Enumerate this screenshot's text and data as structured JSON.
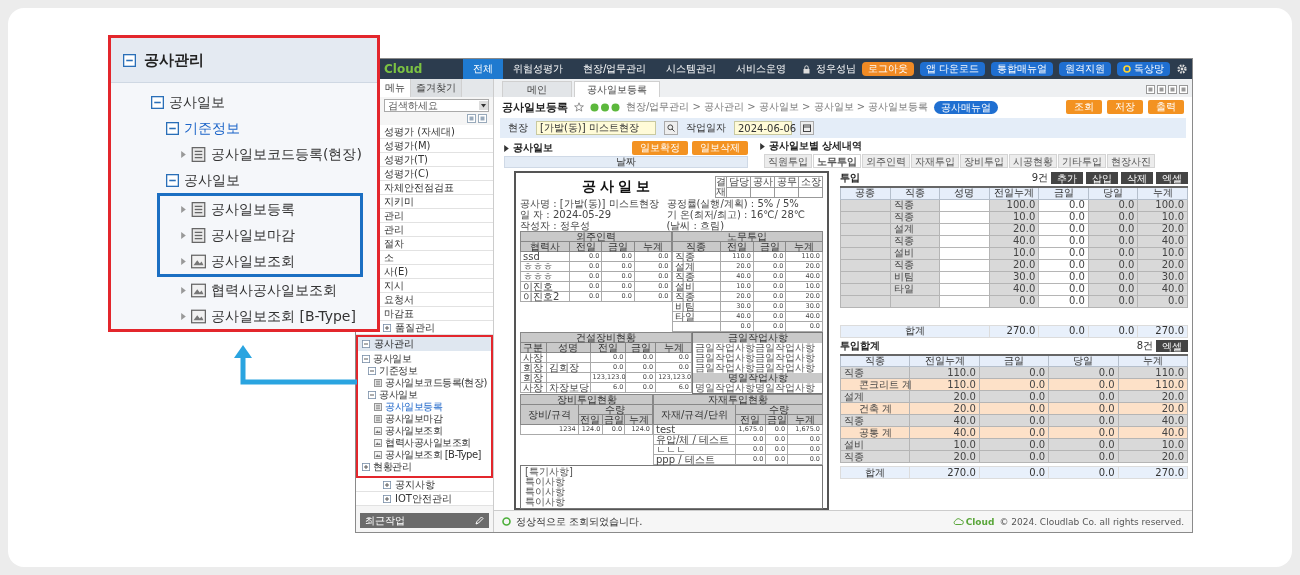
{
  "callout": {
    "title": "공사관리",
    "expanded": true,
    "tree": [
      {
        "label": "공사일보",
        "kind": "folder",
        "expanded": true,
        "selected": false,
        "children": [
          {
            "label": "기준정보",
            "kind": "folder",
            "expanded": true,
            "selected": true,
            "children": [
              {
                "label": "공사일보코드등록(현장)",
                "kind": "document",
                "selected": false
              }
            ]
          },
          {
            "label": "공사일보",
            "kind": "folder",
            "expanded": true,
            "selected": false,
            "children": [
              {
                "label": "공사일보등록",
                "kind": "document",
                "selected": false,
                "framed": true
              },
              {
                "label": "공사일보마감",
                "kind": "document",
                "selected": false,
                "framed": true
              },
              {
                "label": "공사일보조회",
                "kind": "report",
                "selected": false,
                "framed": true
              },
              {
                "label": "협력사공사일보조회",
                "kind": "report",
                "selected": false,
                "framed": false
              },
              {
                "label": "공사일보조회 [B-Type]",
                "kind": "report",
                "selected": false,
                "framed": false
              }
            ]
          }
        ]
      }
    ]
  },
  "topbar": {
    "logo": "Cloud",
    "menus": [
      {
        "label": "전체",
        "selected": true
      },
      {
        "label": "위험성평가",
        "selected": false
      },
      {
        "label": "현장/업무관리",
        "selected": false
      },
      {
        "label": "시스템관리",
        "selected": false
      },
      {
        "label": "서비스운영",
        "selected": false
      }
    ],
    "user": "정우성님",
    "logout": "로그아웃",
    "links": [
      "앱 다운로드",
      "통합매뉴얼",
      "원격지원"
    ],
    "status_link": "독상망"
  },
  "sidebar": {
    "tabs": [
      {
        "label": "메뉴",
        "selected": true
      },
      {
        "label": "즐겨찾기",
        "selected": false
      }
    ],
    "search": "검색하세요",
    "items": [
      {
        "label": "성평가 (자세대)",
        "kind": "plain"
      },
      {
        "label": "성평가(M)",
        "kind": "plain"
      },
      {
        "label": "성평가(T)",
        "kind": "plain"
      },
      {
        "label": "성평가(C)",
        "kind": "plain"
      },
      {
        "label": "자체안전점검표",
        "kind": "plain"
      },
      {
        "label": "지키미",
        "kind": "plain"
      },
      {
        "label": "관리",
        "kind": "plain"
      },
      {
        "label": "관리",
        "kind": "plain"
      },
      {
        "label": "절차",
        "kind": "plain"
      },
      {
        "label": "소",
        "kind": "plain"
      },
      {
        "label": "사(E)",
        "kind": "plain"
      },
      {
        "label": "지시",
        "kind": "plain"
      },
      {
        "label": "요청서",
        "kind": "plain"
      },
      {
        "label": "마감표",
        "kind": "plain"
      },
      {
        "label": "품질관리",
        "kind": "folder",
        "expanded": false
      },
      {
        "label": "공사관리",
        "kind": "folder",
        "expanded": true,
        "framed": true,
        "children": [
          {
            "label": "공사일보",
            "kind": "folder",
            "expanded": true,
            "selected": false,
            "children": [
              {
                "label": "기준정보",
                "kind": "folder",
                "expanded": true,
                "selected": false,
                "children": [
                  {
                    "label": "공사일보코드등록(현장)",
                    "kind": "document",
                    "selected": false
                  }
                ]
              },
              {
                "label": "공사일보",
                "kind": "folder",
                "expanded": true,
                "selected": false,
                "children": [
                  {
                    "label": "공사일보등록",
                    "kind": "document",
                    "selected": true
                  },
                  {
                    "label": "공사일보마감",
                    "kind": "document",
                    "selected": false
                  },
                  {
                    "label": "공사일보조회",
                    "kind": "report",
                    "selected": false
                  },
                  {
                    "label": "협력사공사일보조회",
                    "kind": "report",
                    "selected": false
                  },
                  {
                    "label": "공사일보조회 [B-Type]",
                    "kind": "report",
                    "selected": false
                  }
                ]
              }
            ]
          },
          {
            "label": "현황관리",
            "kind": "folder",
            "expanded": false,
            "selected": false
          }
        ]
      },
      {
        "label": "공지사항",
        "kind": "folder",
        "expanded": false
      },
      {
        "label": "IOT안전관리",
        "kind": "folder",
        "expanded": false
      }
    ],
    "recent": "최근작업"
  },
  "main": {
    "tabs": [
      {
        "label": "메인",
        "selected": false
      },
      {
        "label": "공사일보등록",
        "selected": true
      }
    ],
    "title": "공사일보등록",
    "breadcrumb": "현장/업무관리 > 공사관리 > 공사일보 > 공사일보 > 공사일보등록",
    "manual_button": "공사매뉴얼",
    "actions": [
      "조회",
      "저장",
      "출력"
    ],
    "filters": [
      {
        "label": "현장",
        "value": "[가발(동)] 미스트현장",
        "kind": "search"
      },
      {
        "label": "작업일자",
        "value": "2024-06-06",
        "kind": "date"
      }
    ],
    "daily_panel": {
      "title": "공사일보",
      "buttons": [
        "일보확정",
        "일보삭제"
      ],
      "column": "날짜"
    },
    "report": {
      "title": "공사일보",
      "approval": {
        "label": "결재",
        "roles": [
          "담당",
          "공사",
          "공무",
          "소장"
        ]
      },
      "info_left": [
        "공사명 : [가발(동)] 미스트현장",
        "일 자 : 2024-05-29",
        "작성자 : 정우성"
      ],
      "info_right": [
        "공정률(실행/계획) : 5% / 5%",
        "기 온(최저/최고) : 16℃/ 28℃",
        "(날씨 : 흐림)"
      ],
      "outsourcing": {
        "title": "외주인력",
        "columns": [
          "협력사",
          "전일",
          "금일",
          "누계"
        ],
        "rows": [
          [
            "ssd",
            "0.0",
            "0.0",
            "0.0"
          ],
          [
            "ㅎㅎㅎ",
            "0.0",
            "0.0",
            "0.0"
          ],
          [
            "ㅎㅎㅎ",
            "0.0",
            "0.0",
            "0.0"
          ],
          [
            "이진호",
            "0.0",
            "0.0",
            "0.0"
          ],
          [
            "이진호2",
            "0.0",
            "0.0",
            "0.0"
          ]
        ]
      },
      "labor": {
        "title": "노무투입",
        "columns": [
          "직종",
          "전일",
          "금일",
          "누계"
        ],
        "rows": [
          [
            "직종",
            "110.0",
            "0.0",
            "110.0"
          ],
          [
            "설계",
            "20.0",
            "0.0",
            "20.0"
          ],
          [
            "직종",
            "40.0",
            "0.0",
            "40.0"
          ],
          [
            "설비",
            "10.0",
            "0.0",
            "10.0"
          ],
          [
            "직종",
            "20.0",
            "0.0",
            "20.0"
          ],
          [
            "비팀",
            "30.0",
            "0.0",
            "30.0"
          ],
          [
            "타일",
            "40.0",
            "0.0",
            "40.0"
          ],
          [
            null,
            "0.0",
            "0.0",
            "0.0"
          ]
        ]
      },
      "equipment": {
        "title": "건설장비현황",
        "columns": [
          "구분",
          "성명",
          "전일",
          "금일",
          "누계"
        ],
        "rows": [
          [
            "사장",
            null,
            "0.0",
            "0.0",
            "0.0"
          ],
          [
            "회장",
            "김회장",
            "0.0",
            "0.0",
            "0.0"
          ],
          [
            "회장",
            null,
            "123,123.0",
            "0.0",
            "123,123.0"
          ],
          [
            "사장",
            "차장보당",
            "6.0",
            "0.0",
            "6.0"
          ]
        ]
      },
      "work_notes": [
        {
          "title": "금일작업사항",
          "lines": [
            "금일작업사항금일작업사항",
            "금일작업사항금일작업사항",
            "금일작업사항금일작업사항"
          ]
        },
        {
          "title": "명일작업사항",
          "lines": [
            "명일작업사항명일작업사항"
          ]
        }
      ],
      "equipment_input": {
        "title": "장비투입현황",
        "group": "수량",
        "columns": [
          "장비/규격",
          "전일",
          "금일",
          "누계"
        ],
        "rows": [
          [
            "1234",
            "124.0",
            "0.0",
            "124.0"
          ]
        ]
      },
      "material_input": {
        "title": "자재투입현황",
        "group": "수량",
        "columns": [
          "자재/규격/단위",
          "전일",
          "금일",
          "누계"
        ],
        "rows": [
          [
            "test",
            "1,675.0",
            "0.0",
            "1,675.0"
          ],
          [
            "유압/체 / 테스트",
            "0.0",
            "0.0",
            "0.0"
          ],
          [
            "ㄴㄴㄴ",
            "0.0",
            "0.0",
            "0.0"
          ],
          [
            "ppp / 테스트",
            "0.0",
            "0.0",
            "0.0"
          ]
        ]
      },
      "notes": [
        "[특기사항]",
        "특이사항",
        "특이사항",
        "특이사항"
      ]
    },
    "detail": {
      "title": "공사일보별 상세내역",
      "tabs": [
        {
          "label": "직원투입",
          "selected": false
        },
        {
          "label": "노무투입",
          "selected": true
        },
        {
          "label": "외주인력",
          "selected": false
        },
        {
          "label": "자재투입",
          "selected": false
        },
        {
          "label": "장비투입",
          "selected": false
        },
        {
          "label": "시공현황",
          "selected": false
        },
        {
          "label": "기타투입",
          "selected": false
        },
        {
          "label": "현장사진",
          "selected": false
        }
      ],
      "tables": [
        {
          "title": "투입",
          "count": "9건",
          "buttons": [
            "추가",
            "삽입",
            "삭제",
            "엑셀"
          ],
          "columns": [
            {
              "label": "공종",
              "editable": false
            },
            {
              "label": "직종",
              "editable": false
            },
            {
              "label": "성명",
              "editable": true
            },
            {
              "label": "전일누계",
              "editable": false
            },
            {
              "label": "금일",
              "editable": true
            },
            {
              "label": "당일",
              "editable": false
            },
            {
              "label": "누계",
              "editable": false
            }
          ],
          "rows": [
            {
              "kind": "item",
              "cells": [
                null,
                "직종",
                null,
                "100.0",
                "0.0",
                "0.0",
                "100.0"
              ]
            },
            {
              "kind": "item",
              "cells": [
                null,
                "직종",
                null,
                "10.0",
                "0.0",
                "0.0",
                "10.0"
              ]
            },
            {
              "kind": "item",
              "cells": [
                null,
                "설계",
                null,
                "20.0",
                "0.0",
                "0.0",
                "20.0"
              ]
            },
            {
              "kind": "item",
              "cells": [
                null,
                "직종",
                null,
                "40.0",
                "0.0",
                "0.0",
                "40.0"
              ]
            },
            {
              "kind": "item",
              "cells": [
                null,
                "설비",
                null,
                "10.0",
                "0.0",
                "0.0",
                "10.0"
              ]
            },
            {
              "kind": "item",
              "cells": [
                null,
                "직종",
                null,
                "20.0",
                "0.0",
                "0.0",
                "20.0"
              ]
            },
            {
              "kind": "item",
              "cells": [
                null,
                "비팀",
                null,
                "30.0",
                "0.0",
                "0.0",
                "30.0"
              ]
            },
            {
              "kind": "item",
              "cells": [
                null,
                "타일",
                null,
                "40.0",
                "0.0",
                "0.0",
                "40.0"
              ]
            },
            {
              "kind": "item",
              "cells": [
                null,
                null,
                null,
                "0.0",
                "0.0",
                "0.0",
                "0.0"
              ]
            }
          ],
          "total": {
            "label": "합계",
            "cells": [
              "270.0",
              "0.0",
              "0.0",
              "270.0"
            ]
          }
        },
        {
          "title": "투입합계",
          "count": "8건",
          "buttons": [
            "엑셀"
          ],
          "columns": [
            {
              "label": "직종",
              "editable": false
            },
            {
              "label": "전일누계",
              "editable": false
            },
            {
              "label": "금일",
              "editable": false
            },
            {
              "label": "당일",
              "editable": false
            },
            {
              "label": "누계",
              "editable": false
            }
          ],
          "rows": [
            {
              "kind": "item",
              "cells": [
                "직종",
                "110.0",
                "0.0",
                "0.0",
                "110.0"
              ]
            },
            {
              "kind": "subtotal",
              "cells": [
                "콘크리트 계",
                "110.0",
                "0.0",
                "0.0",
                "110.0"
              ]
            },
            {
              "kind": "item",
              "cells": [
                "설계",
                "20.0",
                "0.0",
                "0.0",
                "20.0"
              ]
            },
            {
              "kind": "subtotal",
              "cells": [
                "건축 계",
                "20.0",
                "0.0",
                "0.0",
                "20.0"
              ]
            },
            {
              "kind": "item",
              "cells": [
                "직종",
                "40.0",
                "0.0",
                "0.0",
                "40.0"
              ]
            },
            {
              "kind": "subtotal",
              "cells": [
                "공통 계",
                "40.0",
                "0.0",
                "0.0",
                "40.0"
              ]
            },
            {
              "kind": "item",
              "cells": [
                "설비",
                "10.0",
                "0.0",
                "0.0",
                "10.0"
              ]
            },
            {
              "kind": "item",
              "cells": [
                "직종",
                "20.0",
                "0.0",
                "0.0",
                "20.0"
              ]
            }
          ],
          "total": {
            "label": "합계",
            "cells": [
              "270.0",
              "0.0",
              "0.0",
              "270.0"
            ]
          }
        }
      ]
    },
    "status": "정상적으로 조회되었습니다.",
    "footer": {
      "logo": "Cloud",
      "copyright": "© 2024. Cloudlab Co. all rights reserved."
    }
  }
}
